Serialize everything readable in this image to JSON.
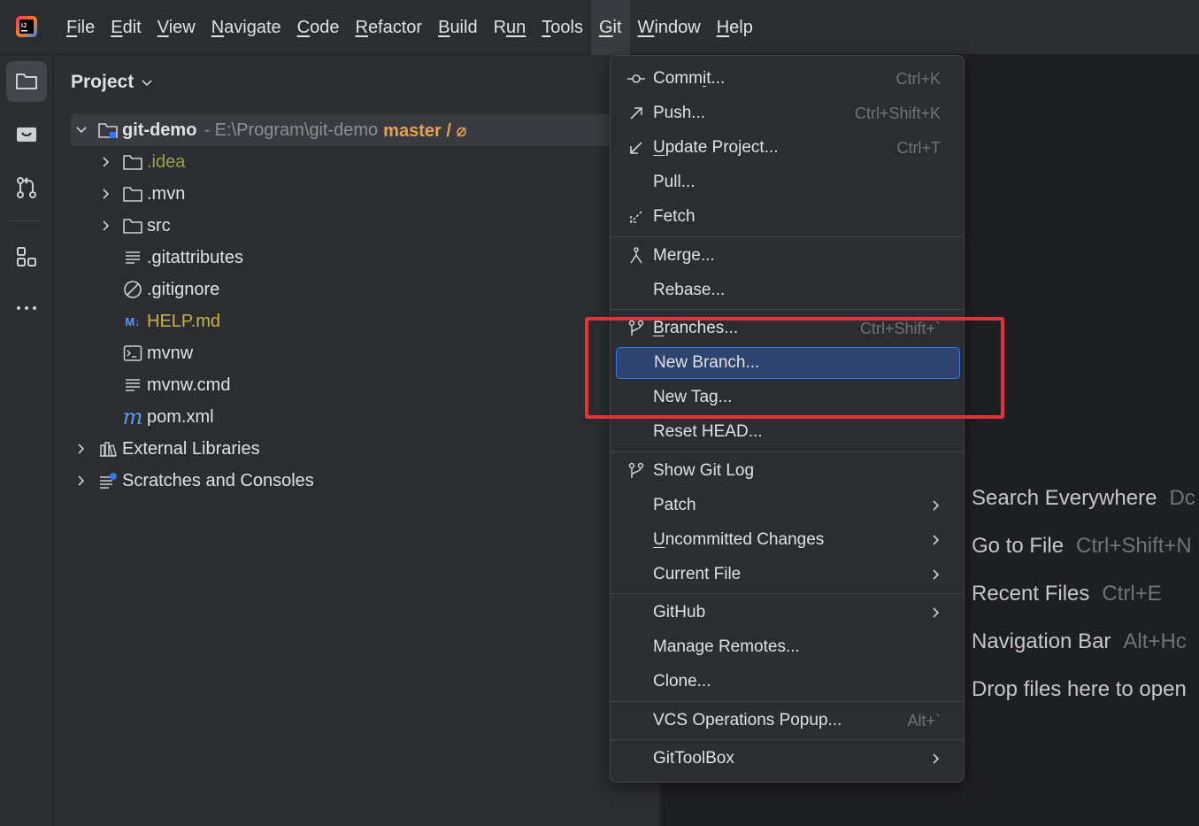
{
  "menubar": {
    "items": [
      {
        "label": "File",
        "mn": "F",
        "rest": "ile"
      },
      {
        "label": "Edit",
        "mn": "E",
        "rest": "dit"
      },
      {
        "label": "View",
        "mn": "V",
        "rest": "iew"
      },
      {
        "label": "Navigate",
        "mn": "N",
        "rest": "avigate"
      },
      {
        "label": "Code",
        "mn": "C",
        "rest": "ode"
      },
      {
        "label": "Refactor",
        "mn": "R",
        "rest": "efactor"
      },
      {
        "label": "Build",
        "mn": "B",
        "rest": "uild"
      },
      {
        "label": "Run",
        "mn": "R",
        "rest": "un",
        "pre": "",
        "mnPos": 1
      },
      {
        "label": "Tools",
        "mn": "T",
        "rest": "ools"
      },
      {
        "label": "Git",
        "mn": "G",
        "rest": "it"
      },
      {
        "label": "Window",
        "mn": "W",
        "rest": "indow"
      },
      {
        "label": "Help",
        "mn": "H",
        "rest": "elp"
      }
    ],
    "active": "Git"
  },
  "project_panel": {
    "title": "Project",
    "root": {
      "name": "git-demo",
      "path": " - E:\\Program\\git-demo",
      "branch": "master / ⌀"
    },
    "children": [
      {
        "name": ".idea",
        "type": "folder",
        "style": "olive"
      },
      {
        "name": ".mvn",
        "type": "folder"
      },
      {
        "name": "src",
        "type": "folder"
      },
      {
        "name": ".gitattributes",
        "type": "text"
      },
      {
        "name": ".gitignore",
        "type": "ignore"
      },
      {
        "name": "HELP.md",
        "type": "markdown",
        "style": "yellowish",
        "badge": "M↓"
      },
      {
        "name": "mvnw",
        "type": "script"
      },
      {
        "name": "mvnw.cmd",
        "type": "text"
      },
      {
        "name": "pom.xml",
        "type": "maven",
        "badge": "m"
      }
    ],
    "external_libraries": "External Libraries",
    "scratches": "Scratches and Consoles"
  },
  "git_menu": {
    "commit": {
      "pre": "Comm",
      "mn": "i",
      "post": "t...",
      "shortcut": "Ctrl+K"
    },
    "push": {
      "label": "Push...",
      "shortcut": "Ctrl+Shift+K"
    },
    "update": {
      "pre": "",
      "mn": "U",
      "post": "pdate Project...",
      "shortcut": "Ctrl+T"
    },
    "pull": {
      "label": "Pull..."
    },
    "fetch": {
      "label": "Fetch"
    },
    "merge": {
      "label": "Merge..."
    },
    "rebase": {
      "label": "Rebase..."
    },
    "branches": {
      "pre": "",
      "mn": "B",
      "post": "ranches...",
      "shortcut": "Ctrl+Shift+`"
    },
    "new_branch": {
      "label": "New Branch..."
    },
    "new_tag": {
      "label": "New Tag..."
    },
    "reset_head": {
      "label": "Reset HEAD..."
    },
    "show_git_log": {
      "label": "Show Git Log"
    },
    "patch": {
      "label": "Patch"
    },
    "uncommitted": {
      "pre": "",
      "mn": "U",
      "post": "ncommitted Changes"
    },
    "current_file": {
      "label": "Current File"
    },
    "github": {
      "label": "GitHub"
    },
    "manage_remotes": {
      "label": "Manage Remotes..."
    },
    "clone": {
      "label": "Clone..."
    },
    "vcs_popup": {
      "label": "VCS Operations Popup...",
      "shortcut": "Alt+`"
    },
    "gittoolbox": {
      "label": "GitToolBox"
    }
  },
  "editor_hints": [
    {
      "label": "Search Everywhere",
      "key": "Dc"
    },
    {
      "label": "Go to File",
      "key": "Ctrl+Shift+N"
    },
    {
      "label": "Recent Files",
      "key": "Ctrl+E"
    },
    {
      "label": "Navigation Bar",
      "key": "Alt+Hc"
    },
    {
      "label": "Drop files here to open",
      "key": ""
    }
  ],
  "colors": {
    "accent": "#3574f0",
    "highlight": "#2e436e",
    "annotation": "#e5323a",
    "branch": "#e8a14f"
  }
}
